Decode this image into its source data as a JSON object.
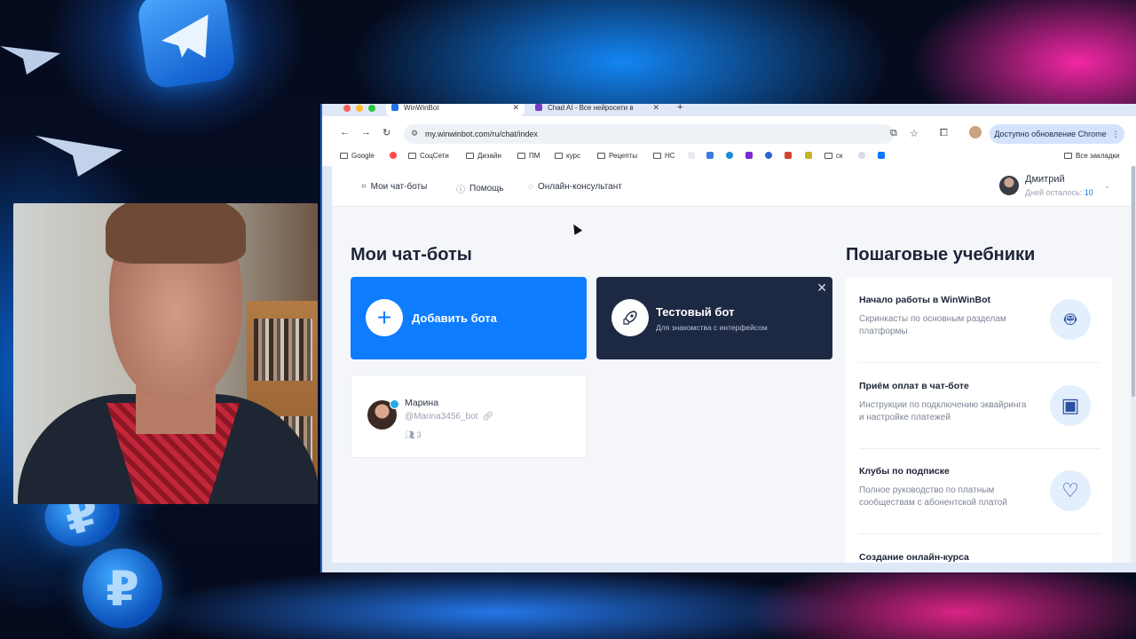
{
  "browser": {
    "tabs": [
      {
        "title": "WinWinBot",
        "active": true
      },
      {
        "title": "Chad AI - Все нейросети в",
        "active": false
      }
    ],
    "new_tab": "+",
    "url": "my.winwinbot.com/ru/chat/index",
    "update_button": "Доступно обновление Chrome",
    "bookmarks": [
      "Google",
      "СоцСети",
      "Дизайн",
      "ПМ",
      "курс",
      "Рецепты",
      "НС",
      "ск"
    ],
    "all_bookmarks": "Все закладки"
  },
  "app": {
    "nav": {
      "my_bots": "Мои чат-боты",
      "help": "Помощь",
      "consultant": "Онлайн-консультант"
    },
    "user": {
      "name": "Дмитрий",
      "days_left_label": "Дней осталось:",
      "days_left_value": "10"
    },
    "my_bots_title": "Мои чат-боты",
    "add_bot": "Добавить бота",
    "test_bot": {
      "title": "Тестовый бот",
      "subtitle": "Для знакомства с интерфейсом"
    },
    "bot": {
      "name": "Марина",
      "handle": "@Marina3456_bot",
      "subscribers": "3"
    },
    "tutorials_title": "Пошаговые учебники",
    "tutorials": [
      {
        "title": "Начало работы в WinWinBot",
        "desc": "Скринкасты по основным разделам платформы",
        "icon": "robot-icon"
      },
      {
        "title": "Приём оплат в чат-боте",
        "desc": "Инструкции по подключению эквайринга и настройке платежей",
        "icon": "wallet-icon"
      },
      {
        "title": "Клубы по подписке",
        "desc": "Полное руководство по платным сообществам с абонентской платой",
        "icon": "heart-chat-icon"
      },
      {
        "title": "Создание онлайн-курса",
        "desc": "",
        "icon": ""
      }
    ]
  },
  "colors": {
    "primary": "#0d7cff",
    "dark_card": "#1d2943",
    "accent_pink": "#ff28aa"
  }
}
